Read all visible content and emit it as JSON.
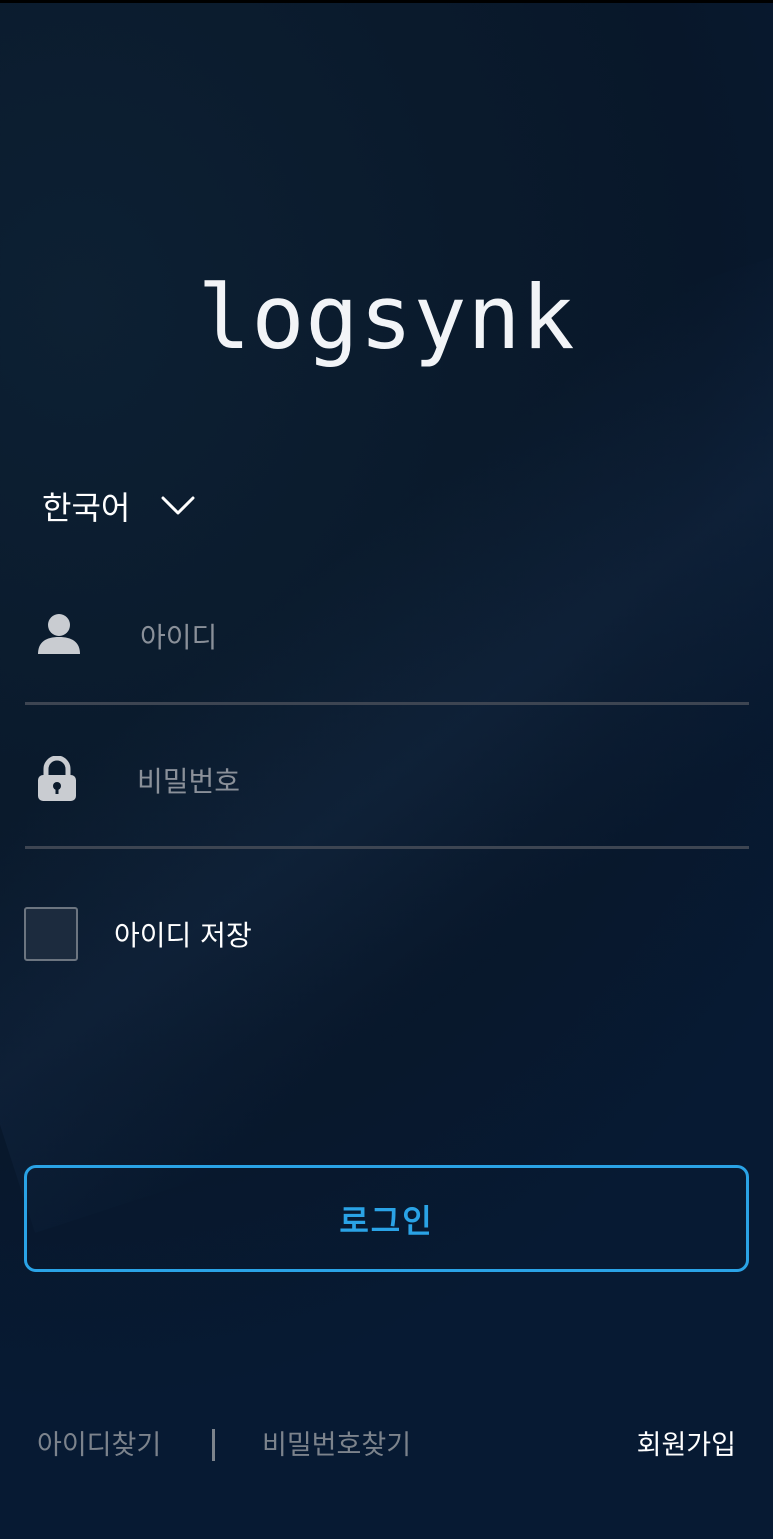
{
  "app": {
    "logo_text": "logsynk"
  },
  "language_selector": {
    "selected": "한국어",
    "icon": "chevron-down-icon"
  },
  "login_form": {
    "username": {
      "placeholder": "아이디",
      "value": "",
      "icon": "user-icon"
    },
    "password": {
      "placeholder": "비밀번호",
      "value": "",
      "icon": "lock-icon"
    },
    "remember_id": {
      "label": "아이디 저장",
      "checked": false
    },
    "submit_label": "로그인"
  },
  "footer_links": {
    "find_id": "아이디찾기",
    "find_password": "비밀번호찾기",
    "signup": "회원가입"
  },
  "colors": {
    "background": "#0a1a2c",
    "accent": "#2aa3e6",
    "muted_text": "#7c838c",
    "divider": "#3d4552"
  }
}
